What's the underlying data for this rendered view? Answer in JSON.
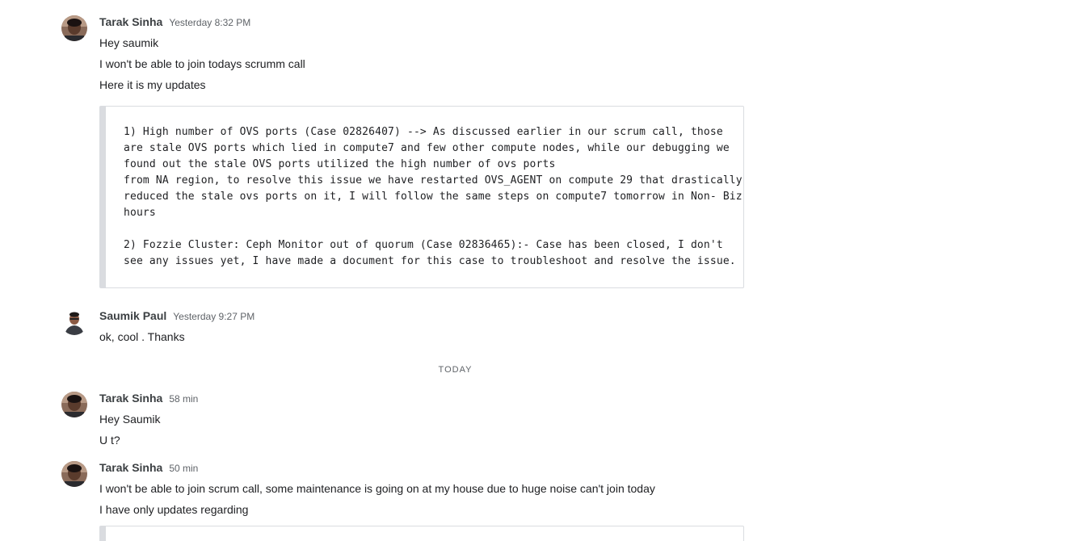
{
  "messages": [
    {
      "sender": "Tarak Sinha",
      "time": "Yesterday 8:32 PM",
      "lines": [
        "Hey saumik",
        "I won't be able to join todays scrumm call",
        "Here it is my updates"
      ],
      "code": "1) High number of OVS ports (Case 02826407) --> As discussed earlier in our scrum call, those are stale OVS ports which lied in compute7 and few other compute nodes, while our debugging we found out the stale OVS ports utilized the high number of ovs ports\nfrom NA region, to resolve this issue we have restarted OVS_AGENT on compute 29 that drastically reduced the stale ovs ports on it, I will follow the same steps on compute7 tomorrow in Non- Biz hours\n\n2) Fozzie Cluster: Ceph Monitor out of quorum (Case 02836465):- Case has been closed, I don't see any issues yet, I have made a document for this case to troubleshoot and resolve the issue."
    },
    {
      "sender": "Saumik Paul",
      "time": "Yesterday 9:27 PM",
      "lines": [
        "ok, cool . Thanks"
      ]
    },
    {
      "sender": "Tarak Sinha",
      "time": "58 min",
      "lines": [
        "Hey Saumik",
        "U t?"
      ]
    },
    {
      "sender": "Tarak Sinha",
      "time": "50 min",
      "lines": [
        "I won't be able to join scrum call, some maintenance is going on at my house due to huge noise can't join today",
        "I have only updates regarding"
      ],
      "code": ""
    }
  ],
  "divider": {
    "label": "TODAY"
  },
  "icons": {
    "avatar_tarak": "user-avatar-photo-icon",
    "avatar_saumik": "user-avatar-photo-icon"
  },
  "colors": {
    "text": "#202124",
    "meta": "#5f6368",
    "code_border": "#dadce0"
  }
}
